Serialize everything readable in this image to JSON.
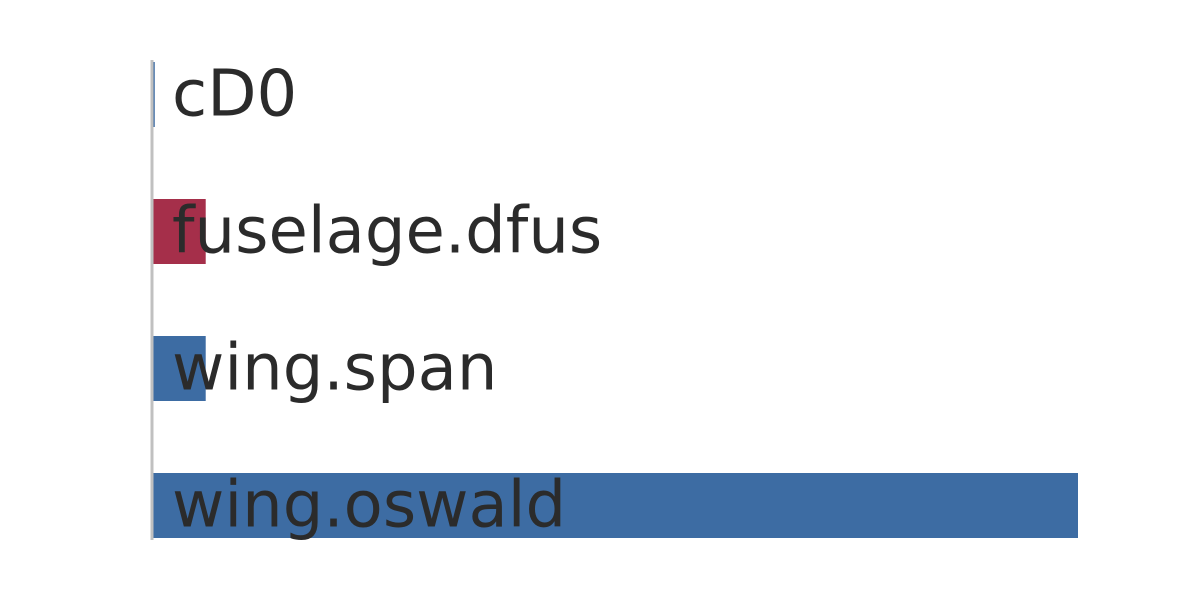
{
  "chart_data": {
    "type": "bar",
    "orientation": "horizontal",
    "categories": [
      "cD0",
      "fuselage.dfus",
      "wing.span",
      "wing.oswald"
    ],
    "values": [
      0.003,
      -0.058,
      0.058,
      1.0
    ],
    "xlim": [
      0,
      1.0
    ],
    "grid": false,
    "colors": {
      "positive": "#3d6ca3",
      "negative": "#a52f4a",
      "axis": "#c0c0c0",
      "label": "#2b2b2b"
    }
  }
}
